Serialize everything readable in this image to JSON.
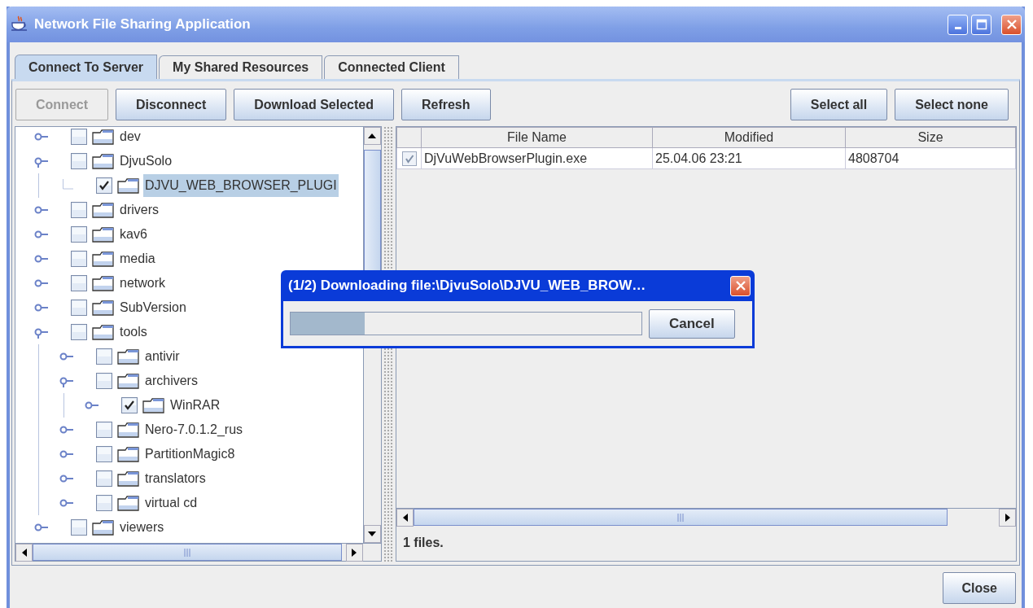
{
  "window": {
    "title": "Network File Sharing Application"
  },
  "tabs": [
    {
      "label": "Connect To Server",
      "selected": true
    },
    {
      "label": "My Shared Resources",
      "selected": false
    },
    {
      "label": "Connected Client",
      "selected": false
    }
  ],
  "toolbar": {
    "buttons": [
      {
        "label": "Connect",
        "disabled": true
      },
      {
        "label": "Disconnect",
        "disabled": false
      },
      {
        "label": "Download Selected",
        "disabled": false
      },
      {
        "label": "Refresh",
        "disabled": false
      }
    ],
    "selection_buttons": [
      {
        "label": "Select all",
        "disabled": false
      },
      {
        "label": "Select none",
        "disabled": false
      }
    ]
  },
  "tree": {
    "items": [
      {
        "label": "dev",
        "kind": "branch",
        "expanded": false,
        "checked": false,
        "selected": false
      },
      {
        "label": "DjvuSolo",
        "kind": "branch",
        "expanded": true,
        "checked": false,
        "selected": false,
        "children": [
          {
            "label": "DJVU_WEB_BROWSER_PLUGI",
            "kind": "leaf",
            "checked": true,
            "selected": true
          }
        ]
      },
      {
        "label": "drivers",
        "kind": "branch",
        "expanded": false,
        "checked": false,
        "selected": false
      },
      {
        "label": "kav6",
        "kind": "branch",
        "expanded": false,
        "checked": false,
        "selected": false
      },
      {
        "label": "media",
        "kind": "branch",
        "expanded": false,
        "checked": false,
        "selected": false
      },
      {
        "label": "network",
        "kind": "branch",
        "expanded": false,
        "checked": false,
        "selected": false
      },
      {
        "label": "SubVersion",
        "kind": "branch",
        "expanded": false,
        "checked": false,
        "selected": false
      },
      {
        "label": "tools",
        "kind": "branch",
        "expanded": true,
        "checked": false,
        "selected": false,
        "children": [
          {
            "label": "antivir",
            "kind": "branch",
            "expanded": false,
            "checked": false,
            "selected": false
          },
          {
            "label": "archivers",
            "kind": "branch",
            "expanded": true,
            "checked": false,
            "selected": false,
            "children": [
              {
                "label": "WinRAR",
                "kind": "branch",
                "expanded": false,
                "checked": true,
                "selected": false
              }
            ]
          },
          {
            "label": "Nero-7.0.1.2_rus",
            "kind": "branch",
            "expanded": false,
            "checked": false,
            "selected": false
          },
          {
            "label": "PartitionMagic8",
            "kind": "branch",
            "expanded": false,
            "checked": false,
            "selected": false
          },
          {
            "label": "translators",
            "kind": "branch",
            "expanded": false,
            "checked": false,
            "selected": false
          },
          {
            "label": "virtual cd",
            "kind": "branch",
            "expanded": false,
            "checked": false,
            "selected": false
          }
        ]
      },
      {
        "label": "viewers",
        "kind": "branch",
        "expanded": false,
        "checked": false,
        "selected": false
      }
    ]
  },
  "file_table": {
    "columns": [
      "File Name",
      "Modified",
      "Size"
    ],
    "rows": [
      {
        "checked": true,
        "cells": [
          "DjVuWebBrowserPlugin.exe",
          "25.04.06 23:21",
          "4808704"
        ]
      }
    ]
  },
  "status": "1 files.",
  "close_button": {
    "label": "Close"
  },
  "progress_dialog": {
    "title": "(1/2) Downloading file:\\DjvuSolo\\DJVU_WEB_BROW…",
    "level": 0.21,
    "cancel_label": "Cancel"
  }
}
